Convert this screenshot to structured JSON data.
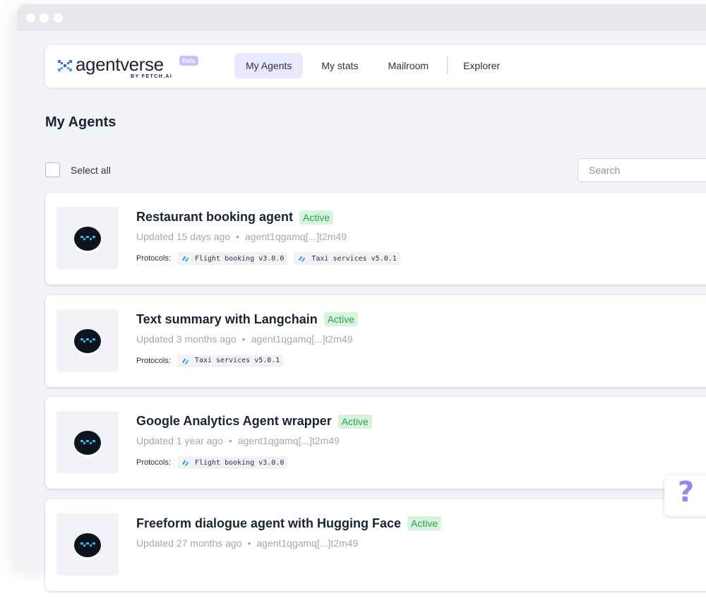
{
  "brand": {
    "name": "agentverse",
    "byline": "BY FETCH.AI",
    "badge": "Beta"
  },
  "nav": {
    "tabs": [
      {
        "label": "My Agents",
        "active": true
      },
      {
        "label": "My stats",
        "active": false
      },
      {
        "label": "Mailroom",
        "active": false
      },
      {
        "label": "Explorer",
        "active": false
      }
    ]
  },
  "page": {
    "title": "My Agents",
    "select_all_label": "Select all",
    "search_placeholder": "Search"
  },
  "protocols_label": "Protocols:",
  "agents": [
    {
      "name": "Restaurant booking agent",
      "status": "Active",
      "updated": "Updated 15 days ago",
      "address": "agent1qgamq[...]t2m49",
      "protocols": [
        "Flight booking v3.0.0",
        "Taxi services v5.0.1"
      ]
    },
    {
      "name": "Text summary with Langchain",
      "status": "Active",
      "updated": "Updated 3 months ago",
      "address": "agent1qgamq[...]t2m49",
      "protocols": [
        "Taxi services v5.0.1"
      ]
    },
    {
      "name": "Google Analytics Agent wrapper",
      "status": "Active",
      "updated": "Updated 1 year ago",
      "address": "agent1qgamq[...]t2m49",
      "protocols": [
        "Flight booking v3.0.0"
      ]
    },
    {
      "name": "Freeform dialogue agent with Hugging Face",
      "status": "Active",
      "updated": "Updated 27 months ago",
      "address": "agent1qgamq[...]t2m49",
      "protocols": []
    }
  ],
  "help": {
    "symbol": "?"
  },
  "colors": {
    "accent": "#ebe9fd",
    "active_badge_bg": "#d8f4df",
    "active_badge_text": "#27a24a",
    "help_icon": "#9b82ee",
    "brand_badge": "#c7c2f7"
  }
}
